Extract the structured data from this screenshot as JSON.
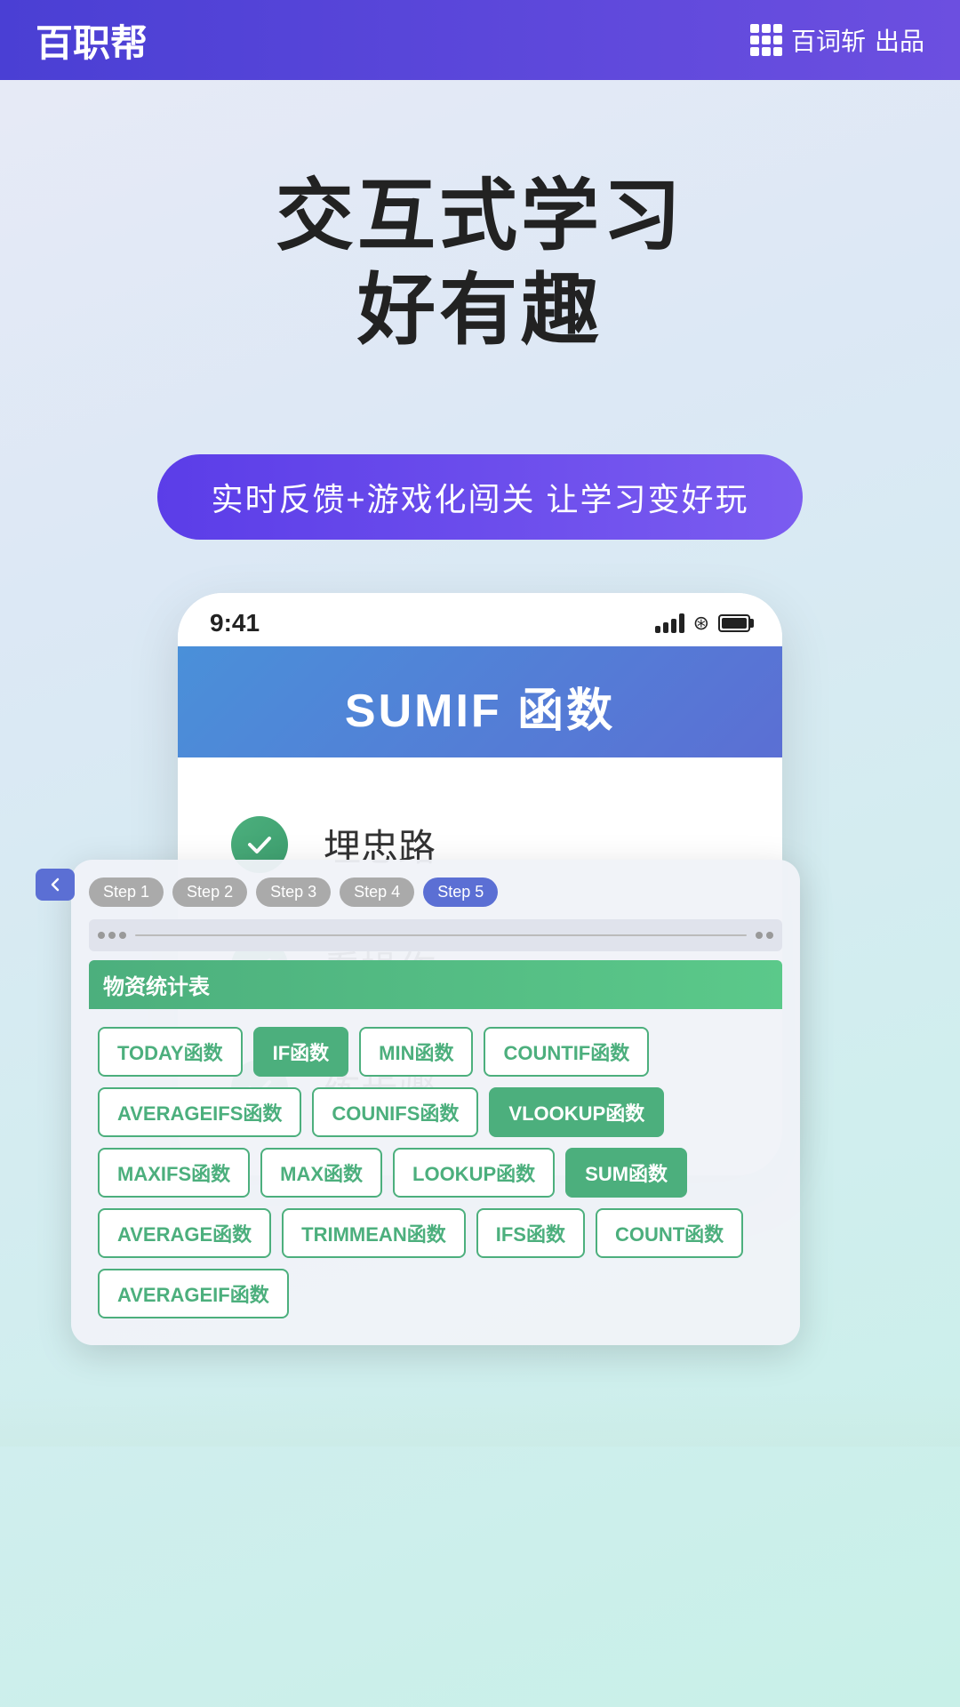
{
  "header": {
    "logo": "百职帮",
    "brand_icon_label": "百词斩",
    "brand_suffix": "出品"
  },
  "hero": {
    "title_line1": "交互式学习",
    "title_line2": "好有趣"
  },
  "badge": {
    "text": "实时反馈+游戏化闯关  让学习变好玩"
  },
  "phone": {
    "status_time": "9:41",
    "banner_text": "SUMIF 函数"
  },
  "overlay": {
    "steps": [
      "Step 1",
      "Step 2",
      "Step 3",
      "Step 4",
      "Step 5"
    ],
    "active_step": 4,
    "sheet_title": "物资统计表",
    "tags": [
      {
        "label": "TODAY函数",
        "filled": false
      },
      {
        "label": "IF函数",
        "filled": true
      },
      {
        "label": "MIN函数",
        "filled": false
      },
      {
        "label": "COUNTIF函数",
        "filled": false
      },
      {
        "label": "AVERAGEIFS函数",
        "filled": false
      },
      {
        "label": "COUNIFS函数",
        "filled": false
      },
      {
        "label": "VLOOKUP函数",
        "filled": true
      },
      {
        "label": "MAXIFS函数",
        "filled": false
      },
      {
        "label": "MAX函数",
        "filled": false
      },
      {
        "label": "LOOKUP函数",
        "filled": false
      },
      {
        "label": "SUM函数",
        "filled": true
      },
      {
        "label": "AVERAGE函数",
        "filled": false
      },
      {
        "label": "TRIMMEAN函数",
        "filled": false
      },
      {
        "label": "IFS函数",
        "filled": false
      },
      {
        "label": "COUNT函数",
        "filled": false
      },
      {
        "label": "AVERAGEIF函数",
        "filled": false
      }
    ]
  },
  "check_items": [
    {
      "label": "埋忠路"
    },
    {
      "label": "看操作"
    },
    {
      "label": "练步骤"
    }
  ]
}
